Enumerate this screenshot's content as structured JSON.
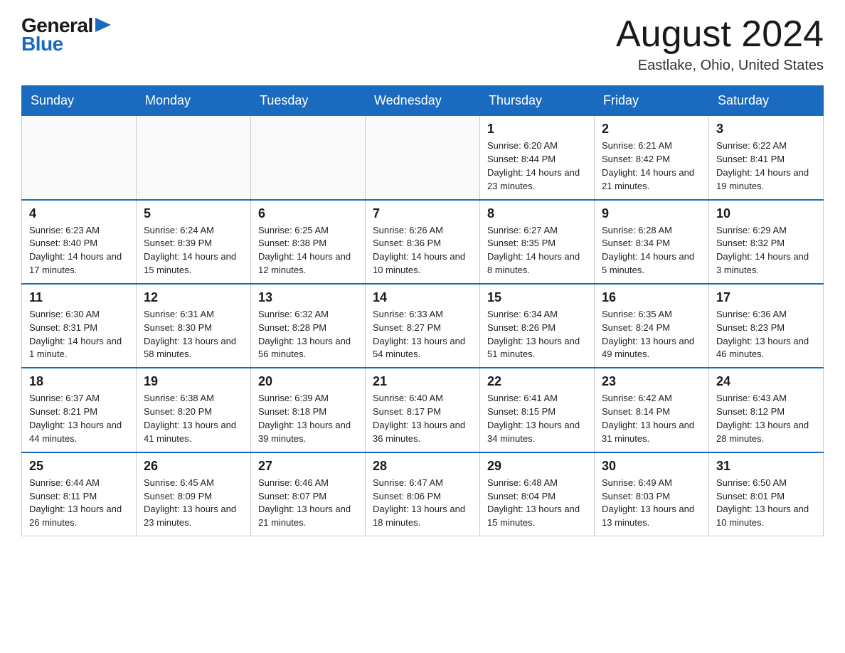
{
  "logo": {
    "general": "General",
    "blue": "Blue",
    "arrow": "▶"
  },
  "title": {
    "month_year": "August 2024",
    "location": "Eastlake, Ohio, United States"
  },
  "weekdays": [
    "Sunday",
    "Monday",
    "Tuesday",
    "Wednesday",
    "Thursday",
    "Friday",
    "Saturday"
  ],
  "weeks": [
    [
      {
        "day": "",
        "info": ""
      },
      {
        "day": "",
        "info": ""
      },
      {
        "day": "",
        "info": ""
      },
      {
        "day": "",
        "info": ""
      },
      {
        "day": "1",
        "info": "Sunrise: 6:20 AM\nSunset: 8:44 PM\nDaylight: 14 hours and 23 minutes."
      },
      {
        "day": "2",
        "info": "Sunrise: 6:21 AM\nSunset: 8:42 PM\nDaylight: 14 hours and 21 minutes."
      },
      {
        "day": "3",
        "info": "Sunrise: 6:22 AM\nSunset: 8:41 PM\nDaylight: 14 hours and 19 minutes."
      }
    ],
    [
      {
        "day": "4",
        "info": "Sunrise: 6:23 AM\nSunset: 8:40 PM\nDaylight: 14 hours and 17 minutes."
      },
      {
        "day": "5",
        "info": "Sunrise: 6:24 AM\nSunset: 8:39 PM\nDaylight: 14 hours and 15 minutes."
      },
      {
        "day": "6",
        "info": "Sunrise: 6:25 AM\nSunset: 8:38 PM\nDaylight: 14 hours and 12 minutes."
      },
      {
        "day": "7",
        "info": "Sunrise: 6:26 AM\nSunset: 8:36 PM\nDaylight: 14 hours and 10 minutes."
      },
      {
        "day": "8",
        "info": "Sunrise: 6:27 AM\nSunset: 8:35 PM\nDaylight: 14 hours and 8 minutes."
      },
      {
        "day": "9",
        "info": "Sunrise: 6:28 AM\nSunset: 8:34 PM\nDaylight: 14 hours and 5 minutes."
      },
      {
        "day": "10",
        "info": "Sunrise: 6:29 AM\nSunset: 8:32 PM\nDaylight: 14 hours and 3 minutes."
      }
    ],
    [
      {
        "day": "11",
        "info": "Sunrise: 6:30 AM\nSunset: 8:31 PM\nDaylight: 14 hours and 1 minute."
      },
      {
        "day": "12",
        "info": "Sunrise: 6:31 AM\nSunset: 8:30 PM\nDaylight: 13 hours and 58 minutes."
      },
      {
        "day": "13",
        "info": "Sunrise: 6:32 AM\nSunset: 8:28 PM\nDaylight: 13 hours and 56 minutes."
      },
      {
        "day": "14",
        "info": "Sunrise: 6:33 AM\nSunset: 8:27 PM\nDaylight: 13 hours and 54 minutes."
      },
      {
        "day": "15",
        "info": "Sunrise: 6:34 AM\nSunset: 8:26 PM\nDaylight: 13 hours and 51 minutes."
      },
      {
        "day": "16",
        "info": "Sunrise: 6:35 AM\nSunset: 8:24 PM\nDaylight: 13 hours and 49 minutes."
      },
      {
        "day": "17",
        "info": "Sunrise: 6:36 AM\nSunset: 8:23 PM\nDaylight: 13 hours and 46 minutes."
      }
    ],
    [
      {
        "day": "18",
        "info": "Sunrise: 6:37 AM\nSunset: 8:21 PM\nDaylight: 13 hours and 44 minutes."
      },
      {
        "day": "19",
        "info": "Sunrise: 6:38 AM\nSunset: 8:20 PM\nDaylight: 13 hours and 41 minutes."
      },
      {
        "day": "20",
        "info": "Sunrise: 6:39 AM\nSunset: 8:18 PM\nDaylight: 13 hours and 39 minutes."
      },
      {
        "day": "21",
        "info": "Sunrise: 6:40 AM\nSunset: 8:17 PM\nDaylight: 13 hours and 36 minutes."
      },
      {
        "day": "22",
        "info": "Sunrise: 6:41 AM\nSunset: 8:15 PM\nDaylight: 13 hours and 34 minutes."
      },
      {
        "day": "23",
        "info": "Sunrise: 6:42 AM\nSunset: 8:14 PM\nDaylight: 13 hours and 31 minutes."
      },
      {
        "day": "24",
        "info": "Sunrise: 6:43 AM\nSunset: 8:12 PM\nDaylight: 13 hours and 28 minutes."
      }
    ],
    [
      {
        "day": "25",
        "info": "Sunrise: 6:44 AM\nSunset: 8:11 PM\nDaylight: 13 hours and 26 minutes."
      },
      {
        "day": "26",
        "info": "Sunrise: 6:45 AM\nSunset: 8:09 PM\nDaylight: 13 hours and 23 minutes."
      },
      {
        "day": "27",
        "info": "Sunrise: 6:46 AM\nSunset: 8:07 PM\nDaylight: 13 hours and 21 minutes."
      },
      {
        "day": "28",
        "info": "Sunrise: 6:47 AM\nSunset: 8:06 PM\nDaylight: 13 hours and 18 minutes."
      },
      {
        "day": "29",
        "info": "Sunrise: 6:48 AM\nSunset: 8:04 PM\nDaylight: 13 hours and 15 minutes."
      },
      {
        "day": "30",
        "info": "Sunrise: 6:49 AM\nSunset: 8:03 PM\nDaylight: 13 hours and 13 minutes."
      },
      {
        "day": "31",
        "info": "Sunrise: 6:50 AM\nSunset: 8:01 PM\nDaylight: 13 hours and 10 minutes."
      }
    ]
  ]
}
